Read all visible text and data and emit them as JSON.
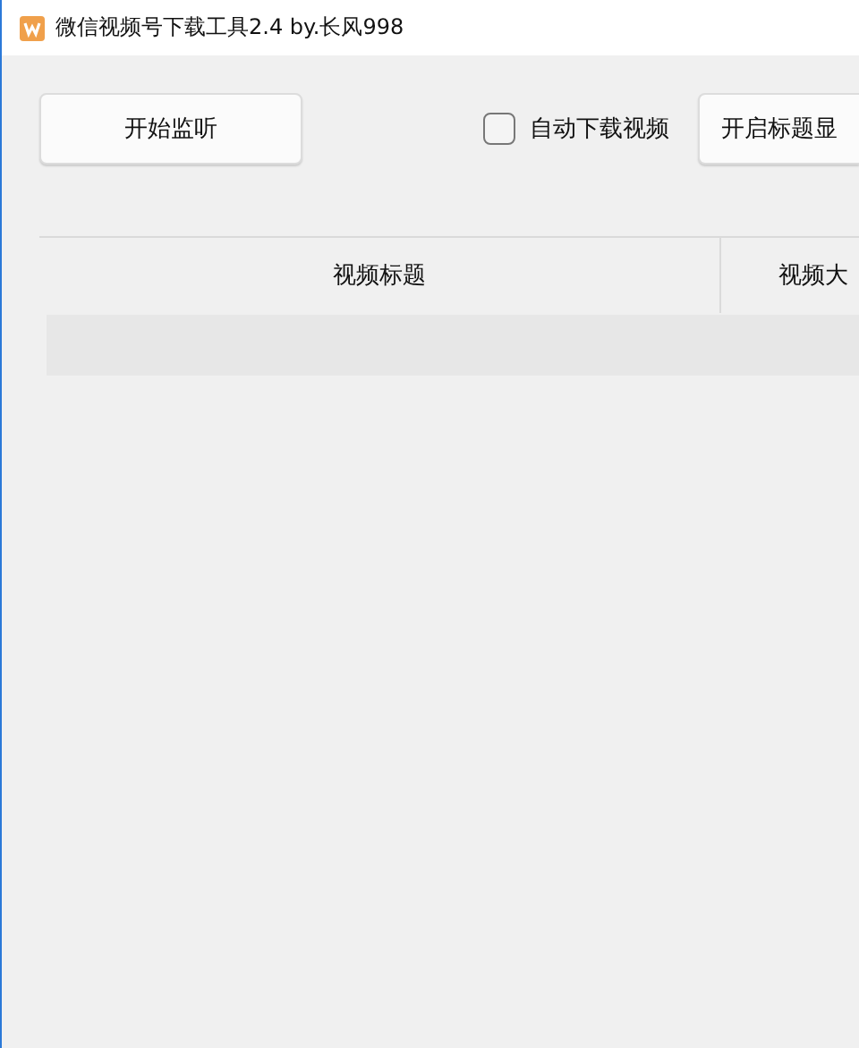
{
  "window": {
    "title": "微信视频号下载工具2.4 by.长风998"
  },
  "toolbar": {
    "start_button": "开始监听",
    "auto_download": {
      "label": "自动下载视频",
      "checked": false
    },
    "title_button": "开启标题显"
  },
  "table": {
    "columns": [
      "视频标题",
      "视频大"
    ],
    "rows": [
      {
        "kind": "empty",
        "selected": false
      }
    ]
  }
}
